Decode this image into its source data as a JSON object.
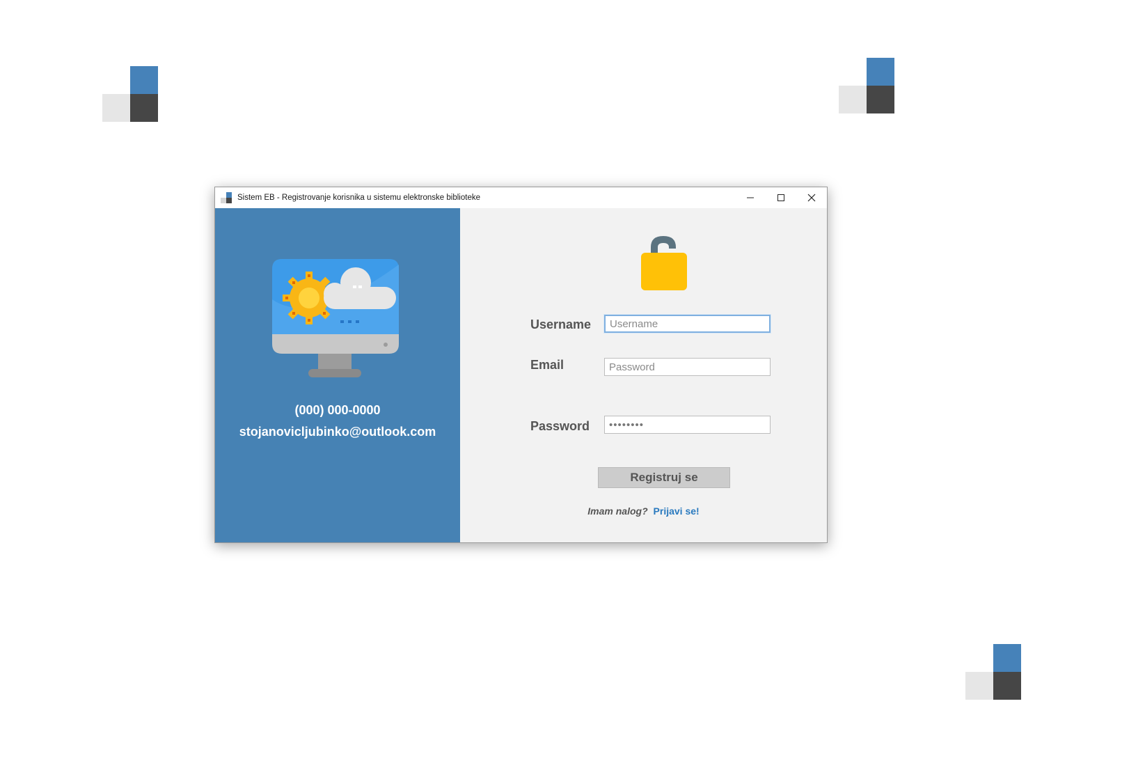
{
  "window": {
    "title": "Sistem EB - Registrovanje korisnika u sistemu elektronske biblioteke",
    "controls": {
      "minimize_icon": "minimize-icon",
      "maximize_icon": "maximize-icon",
      "close_icon": "close-icon"
    }
  },
  "left_panel": {
    "illustration": "monitor-settings-cloud-icon",
    "phone": "(000) 000-0000",
    "email": "stojanovicljubinko@outlook.com"
  },
  "form": {
    "lock_icon": "unlocked-padlock-icon",
    "username_label": "Username",
    "username_placeholder": "Username",
    "email_label": "Email",
    "email_placeholder": "Password",
    "password_label": "Password",
    "password_value": "••••••••",
    "register_button": "Registruj se",
    "have_account_text": "Imam nalog?",
    "login_link": "Prijavi se!"
  },
  "colors": {
    "brand_blue": "#4682b4",
    "panel_gray": "#f2f2f2",
    "lock_yellow": "#ffc107",
    "link_blue": "#2a7abf",
    "deco_dark": "#464646",
    "deco_light": "#e6e6e6"
  }
}
